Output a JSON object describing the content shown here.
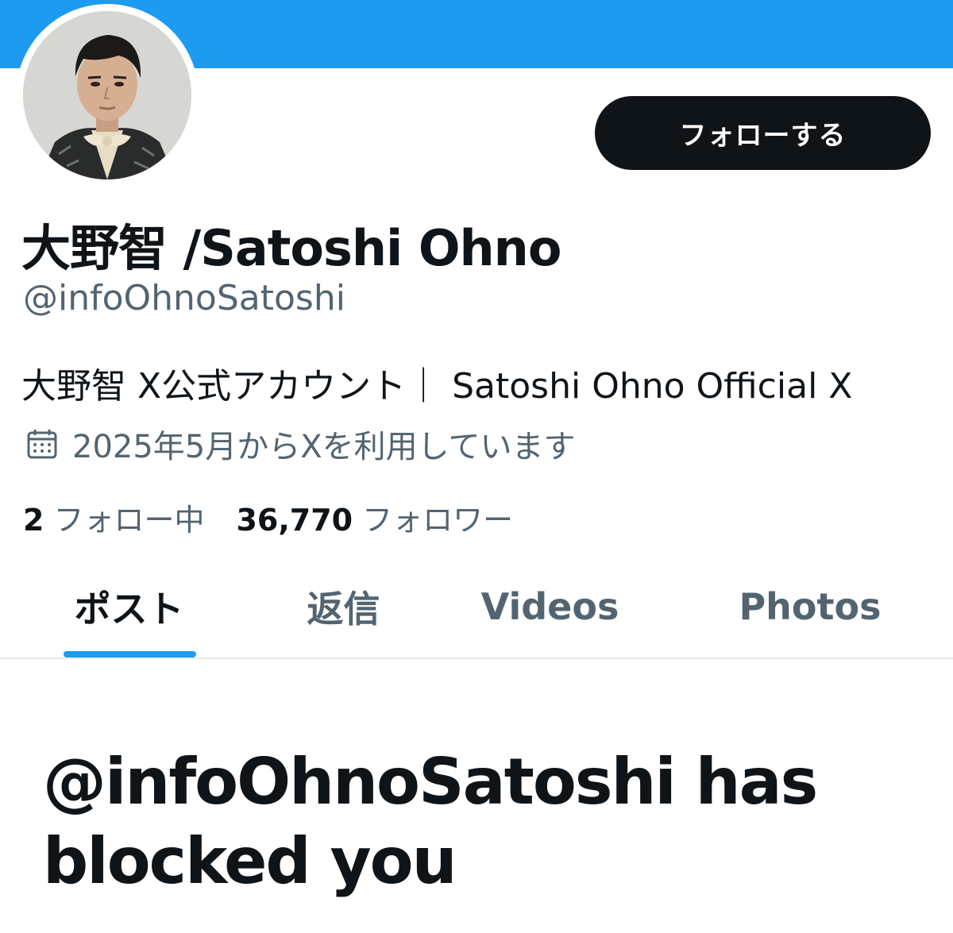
{
  "profile": {
    "display_name": "大野智 /Satoshi Ohno",
    "handle": "@infoOhnoSatoshi",
    "bio": "大野智 X公式アカウント｜ Satoshi Ohno Official X",
    "joined": "2025年5月からXを利用しています",
    "joined_icon": "calendar-icon"
  },
  "actions": {
    "follow_label": "フォローする"
  },
  "stats": {
    "following_count": "2",
    "following_label": "フォロー中",
    "followers_count": "36,770",
    "followers_label": "フォロワー"
  },
  "tabs": [
    {
      "label": "ポスト",
      "active": true
    },
    {
      "label": "返信",
      "active": false
    },
    {
      "label": "Videos",
      "active": false
    },
    {
      "label": "Photos",
      "active": false
    }
  ],
  "blocked": {
    "message": "@infoOhnoSatoshi has blocked you"
  },
  "colors": {
    "accent": "#1d9bf0",
    "text_primary": "#0f1419",
    "text_secondary": "#536471",
    "button_bg": "#0f1419"
  }
}
